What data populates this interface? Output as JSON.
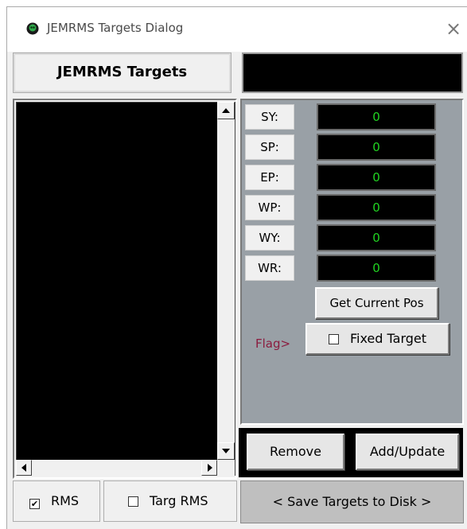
{
  "window": {
    "title": "JEMRMS Targets Dialog",
    "close_glyph": "×",
    "app_icon": "green-eye-icon"
  },
  "header": {
    "button_label": "JEMRMS Targets"
  },
  "joints": [
    {
      "label": "SY:",
      "value": "0"
    },
    {
      "label": "SP:",
      "value": "0"
    },
    {
      "label": "EP:",
      "value": "0"
    },
    {
      "label": "WP:",
      "value": "0"
    },
    {
      "label": "WY:",
      "value": "0"
    },
    {
      "label": "WR:",
      "value": "0"
    }
  ],
  "buttons": {
    "get_current_pos": "Get Current Pos",
    "remove": "Remove",
    "add_update": "Add/Update",
    "save_targets": "< Save Targets to Disk >"
  },
  "flag": {
    "label": "Flag>",
    "fixed_target_label": "Fixed Target",
    "fixed_target_checked": false
  },
  "checkboxes": {
    "rms": {
      "label": "RMS",
      "checked": true
    },
    "targ_rms": {
      "label": "Targ RMS",
      "checked": false
    }
  },
  "colors": {
    "value_text": "#21d421",
    "flag_text": "#8b1c3f",
    "panel_bg": "#99a0a6"
  }
}
